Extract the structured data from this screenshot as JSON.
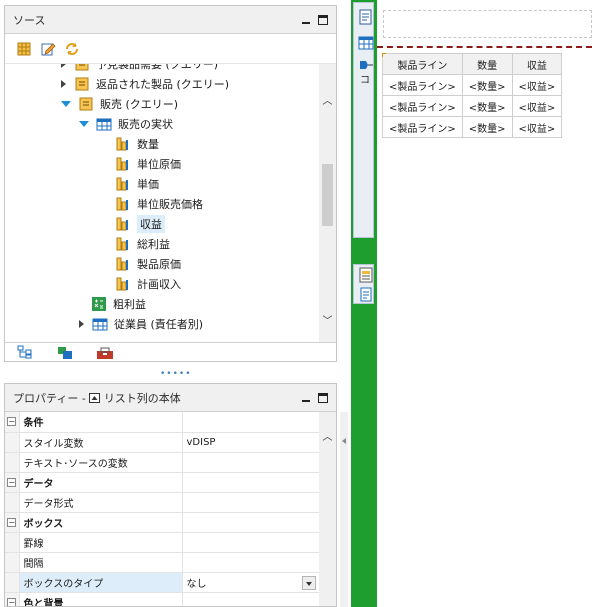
{
  "source_pane": {
    "title": "ソース",
    "tree": [
      {
        "label": "予見製品需要 (クエリー)",
        "indent": 56,
        "expander": "right",
        "icon": "query-icon"
      },
      {
        "label": "返品された製品 (クエリー)",
        "indent": 56,
        "expander": "right",
        "icon": "query-icon"
      },
      {
        "label": "販売 (クエリー)",
        "indent": 56,
        "expander": "down",
        "icon": "query-icon"
      },
      {
        "label": "販売の実状",
        "indent": 74,
        "expander": "down",
        "icon": "table-icon"
      },
      {
        "label": "数量",
        "indent": 110,
        "expander": "none",
        "icon": "measure-icon"
      },
      {
        "label": "単位原価",
        "indent": 110,
        "expander": "none",
        "icon": "measure-icon"
      },
      {
        "label": "単価",
        "indent": 110,
        "expander": "none",
        "icon": "measure-icon"
      },
      {
        "label": "単位販売価格",
        "indent": 110,
        "expander": "none",
        "icon": "measure-icon"
      },
      {
        "label": "収益",
        "indent": 110,
        "expander": "none",
        "icon": "measure-icon",
        "selected": true
      },
      {
        "label": "総利益",
        "indent": 110,
        "expander": "none",
        "icon": "measure-icon"
      },
      {
        "label": "製品原価",
        "indent": 110,
        "expander": "none",
        "icon": "measure-icon"
      },
      {
        "label": "計画収入",
        "indent": 110,
        "expander": "none",
        "icon": "measure-icon"
      },
      {
        "label": "粗利益",
        "indent": 86,
        "expander": "none",
        "icon": "calc-icon"
      },
      {
        "label": "従業員 (責任者別)",
        "indent": 74,
        "expander": "right",
        "icon": "table-icon"
      }
    ],
    "tabs": [
      "source-tree-tab",
      "data-items-tab",
      "toolbox-tab"
    ]
  },
  "properties_pane": {
    "title": "プロパティー - ",
    "context": "リスト列の本体",
    "rows": [
      {
        "type": "category",
        "name": "条件",
        "value": ""
      },
      {
        "type": "prop",
        "name": "スタイル変数",
        "value": "vDISP"
      },
      {
        "type": "prop",
        "name": "テキスト･ソースの変数",
        "value": ""
      },
      {
        "type": "category",
        "name": "データ",
        "value": ""
      },
      {
        "type": "prop",
        "name": "データ形式",
        "value": ""
      },
      {
        "type": "category",
        "name": "ボックス",
        "value": ""
      },
      {
        "type": "prop",
        "name": "罫線",
        "value": ""
      },
      {
        "type": "prop",
        "name": "間隔",
        "value": ""
      },
      {
        "type": "prop",
        "name": "ボックスのタイプ",
        "value": "なし",
        "dropdown": true,
        "highlight": true
      },
      {
        "type": "category",
        "name": "色と背景",
        "value": ""
      }
    ]
  },
  "palette": {
    "labels": [
      "コ"
    ]
  },
  "report_list": {
    "headers": [
      "製品ライン",
      "数量",
      "収益"
    ],
    "rows": [
      [
        "<製品ライン>",
        "<数量>",
        "<収益>"
      ],
      [
        "<製品ライン>",
        "<数量>",
        "<収益>"
      ],
      [
        "<製品ライン>",
        "<数量>",
        "<収益>"
      ]
    ]
  }
}
